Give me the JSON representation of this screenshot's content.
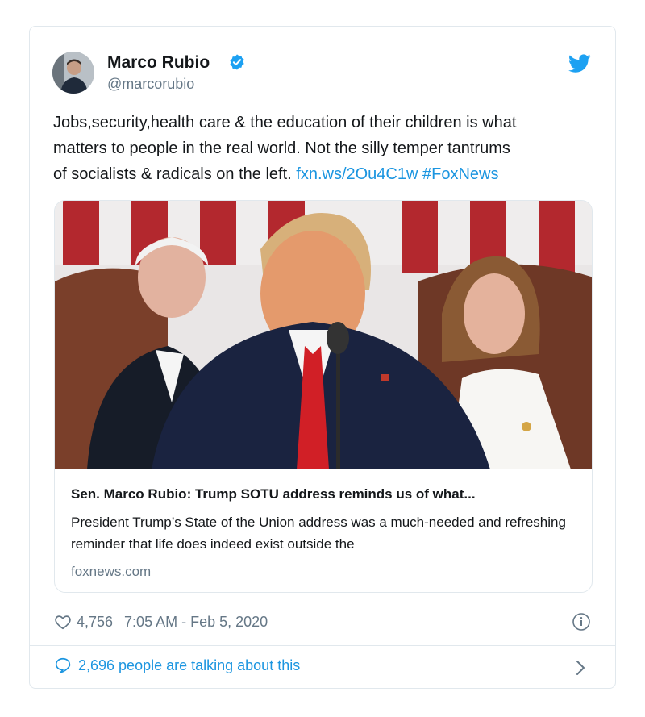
{
  "author": {
    "name": "Marco Rubio",
    "handle": "@marcorubio"
  },
  "tweet": {
    "text_line1": "Jobs,security,health care & the education of their children is what",
    "text_line2": "matters to people in the real world. Not the silly temper tantrums",
    "text_line3": "of socialists & radicals on the left.",
    "link": "fxn.ws/2Ou4C1w",
    "hashtag": "#FoxNews"
  },
  "link_card": {
    "title": "Sen. Marco Rubio: Trump SOTU address reminds us of what...",
    "description": "President Trump’s State of the Union address was a much-needed and refreshing reminder that life does indeed exist outside the",
    "domain": "foxnews.com"
  },
  "meta": {
    "likes": "4,756",
    "timestamp": "7:05 AM - Feb 5, 2020"
  },
  "footer": {
    "talking": "2,696 people are talking about this"
  },
  "icons": {
    "verified": "verified-badge-icon",
    "bird": "twitter-bird-icon",
    "heart": "heart-icon",
    "info": "info-icon",
    "bubble": "speech-bubble-icon",
    "chevron": "chevron-right-icon"
  },
  "colors": {
    "accent": "#1b95e0",
    "muted": "#657786",
    "border": "#e1e8ed",
    "text": "#14171a"
  }
}
